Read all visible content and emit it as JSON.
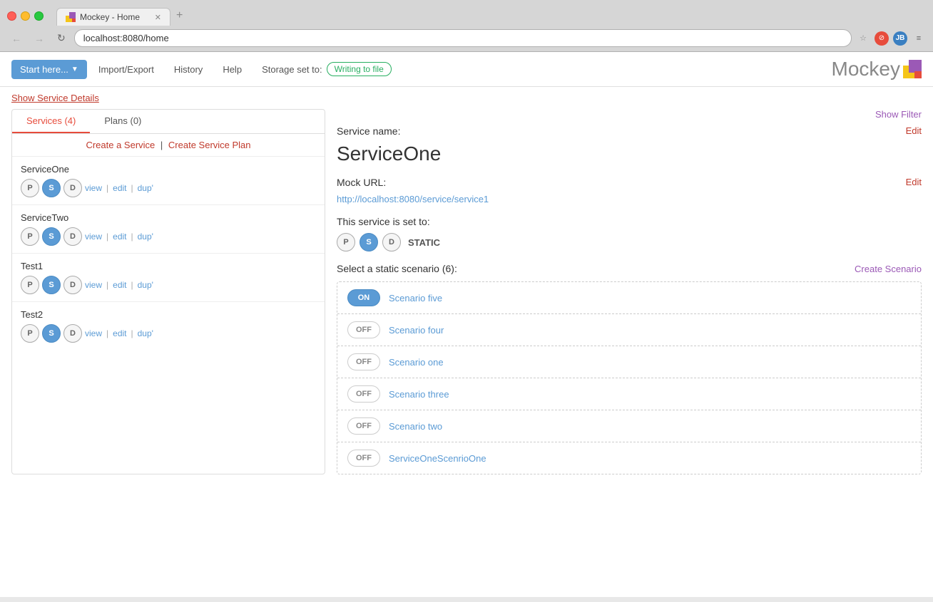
{
  "browser": {
    "tab_title": "Mockey - Home",
    "address": "localhost:8080/home",
    "user_initial": "JB"
  },
  "nav": {
    "start_here": "Start here...",
    "import_export": "Import/Export",
    "history": "History",
    "help": "Help",
    "storage_label": "Storage set to:",
    "storage_status": "Writing to file",
    "brand_name": "Mockey"
  },
  "show_details": "Show Service Details",
  "show_filter": "Show Filter",
  "left_panel": {
    "tab_services_label": "Services (4)",
    "tab_plans_label": "Plans (0)",
    "create_service": "Create a Service",
    "create_plan": "Create Service Plan",
    "services": [
      {
        "name": "ServiceOne",
        "badge_p": "P",
        "badge_s": "S",
        "badge_d": "D",
        "view": "view",
        "edit": "edit",
        "dup": "dup'"
      },
      {
        "name": "ServiceTwo",
        "badge_p": "P",
        "badge_s": "S",
        "badge_d": "D",
        "view": "view",
        "edit": "edit",
        "dup": "dup'"
      },
      {
        "name": "Test1",
        "badge_p": "P",
        "badge_s": "S",
        "badge_d": "D",
        "view": "view",
        "edit": "edit",
        "dup": "dup'"
      },
      {
        "name": "Test2",
        "badge_p": "P",
        "badge_s": "S",
        "badge_d": "D",
        "view": "view",
        "edit": "edit",
        "dup": "dup'"
      }
    ]
  },
  "right_panel": {
    "service_name_label": "Service name:",
    "edit_label": "Edit",
    "service_name_value": "ServiceOne",
    "mock_url_label": "Mock URL:",
    "mock_url_edit": "Edit",
    "mock_url_value": "http://localhost:8080/service/service1",
    "set_to_label": "This service is set to:",
    "badge_p": "P",
    "badge_s": "S",
    "badge_d": "D",
    "mode_label": "STATIC",
    "scenario_title": "Select a static scenario (6):",
    "create_scenario": "Create Scenario",
    "scenarios": [
      {
        "name": "Scenario five",
        "state": "ON",
        "active": true
      },
      {
        "name": "Scenario four",
        "state": "OFF",
        "active": false
      },
      {
        "name": "Scenario one",
        "state": "OFF",
        "active": false
      },
      {
        "name": "Scenario three",
        "state": "OFF",
        "active": false
      },
      {
        "name": "Scenario two",
        "state": "OFF",
        "active": false
      },
      {
        "name": "ServiceOneScenrioOne",
        "state": "OFF",
        "active": false
      }
    ]
  }
}
